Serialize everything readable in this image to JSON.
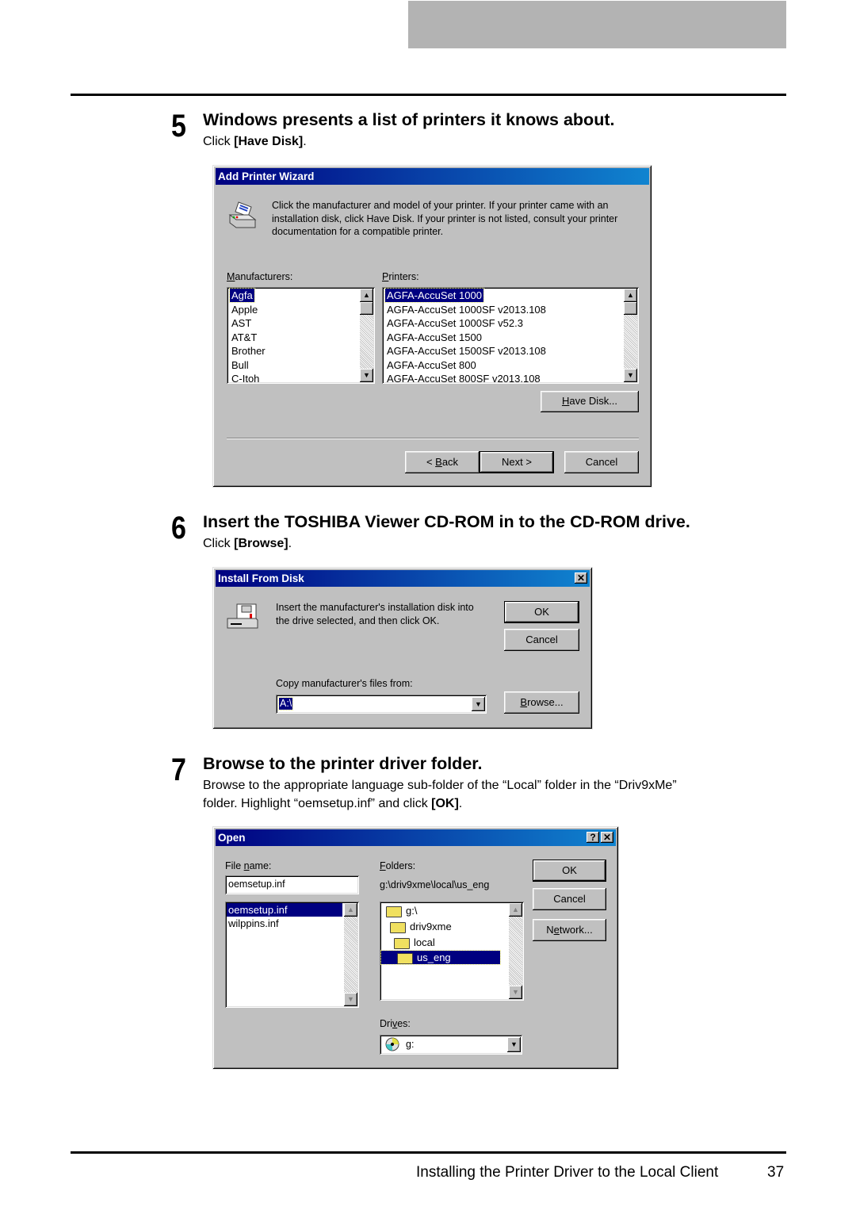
{
  "page": {
    "footer_title": "Installing the Printer Driver to the Local Client",
    "page_number": "37"
  },
  "steps": [
    {
      "number": "5",
      "title": "Windows presents a list of printers it knows about.",
      "body_prefix": "Click ",
      "body_bold": "[Have Disk]",
      "body_suffix": "."
    },
    {
      "number": "6",
      "title": "Insert the TOSHIBA Viewer CD-ROM in to the CD-ROM drive.",
      "body_prefix": "Click ",
      "body_bold": "[Browse]",
      "body_suffix": "."
    },
    {
      "number": "7",
      "title": "Browse to the printer driver folder.",
      "body_line1": "Browse to the appropriate language sub-folder of the “Local” folder in the “Driv9xMe”",
      "body_line2_prefix": "folder. Highlight “oemsetup.inf” and click ",
      "body_bold": "[OK]",
      "body_suffix": "."
    }
  ],
  "add_printer_wizard": {
    "title": "Add Printer Wizard",
    "icon": "printer-icon",
    "instructions": [
      "Click the manufacturer and model of your printer. If your printer came with an",
      "installation disk, click Have Disk. If your printer is not listed, consult your printer",
      "documentation for a compatible printer."
    ],
    "manufacturers_label_u": "M",
    "manufacturers_label_rest": "anufacturers:",
    "manufacturers": [
      "Agfa",
      "Apple",
      "AST",
      "AT&T",
      "Brother",
      "Bull",
      "C-Itoh"
    ],
    "manufacturers_selected": "Agfa",
    "printers_label_u": "P",
    "printers_label_rest": "rinters:",
    "printers": [
      "AGFA-AccuSet 1000",
      "AGFA-AccuSet 1000SF v2013.108",
      "AGFA-AccuSet 1000SF v52.3",
      "AGFA-AccuSet 1500",
      "AGFA-AccuSet 1500SF v2013.108",
      "AGFA-AccuSet 800",
      "AGFA-AccuSet 800SF v2013.108"
    ],
    "printers_selected": "AGFA-AccuSet 1000",
    "have_disk_u": "H",
    "have_disk_rest": "ave Disk...",
    "back_prefix": "< ",
    "back_u": "B",
    "back_rest": "ack",
    "next_label": "Next >",
    "cancel_label": "Cancel"
  },
  "install_from_disk": {
    "title": "Install From Disk",
    "close_glyph": "✕",
    "icon": "disk-drive-icon",
    "message_line1": "Insert the manufacturer's installation disk into",
    "message_line2": "the drive selected, and then click OK.",
    "ok_label": "OK",
    "cancel_label": "Cancel",
    "copy_label": "Copy manufacturer's files from:",
    "copy_value": "A:\\",
    "browse_u": "B",
    "browse_rest": "rowse..."
  },
  "open_dialog": {
    "title": "Open",
    "help_glyph": "?",
    "close_glyph": "✕",
    "file_name_label_prefix": "File ",
    "file_name_label_u": "n",
    "file_name_label_rest": "ame:",
    "file_name_value": "oemsetup.inf",
    "files": [
      "oemsetup.inf",
      "wilppins.inf"
    ],
    "files_selected": "oemsetup.inf",
    "folders_label_u": "F",
    "folders_label_rest": "olders:",
    "current_path": "g:\\driv9xme\\local\\us_eng",
    "folders": [
      "g:\\",
      "driv9xme",
      "local",
      "us_eng"
    ],
    "folders_selected": "us_eng",
    "drives_label_prefix": "Dri",
    "drives_label_u": "v",
    "drives_label_rest": "es:",
    "drive_value": "g:",
    "ok_label": "OK",
    "cancel_label": "Cancel",
    "network_prefix": "N",
    "network_u": "e",
    "network_rest": "twork..."
  }
}
